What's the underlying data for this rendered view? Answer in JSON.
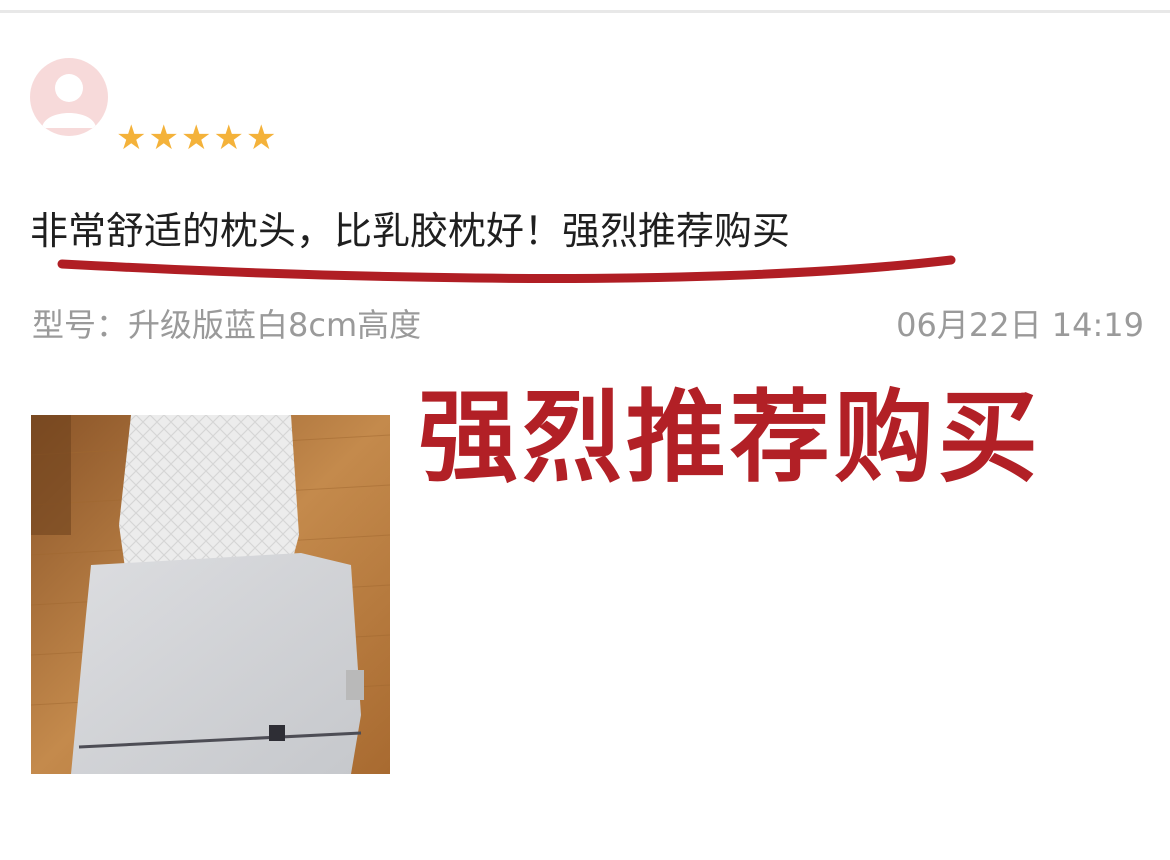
{
  "review": {
    "rating_stars": 5,
    "stars": [
      "★",
      "★",
      "★",
      "★",
      "★"
    ],
    "text": "非常舒适的枕头，比乳胶枕好！强烈推荐购买",
    "spec": "型号：升级版蓝白8cm高度",
    "date": "06月22日 14:19"
  },
  "overlay": {
    "text": "强烈推荐购买"
  },
  "colors": {
    "star": "#f4b23a",
    "overlay_red": "#b22026",
    "underline_red": "#b01e24",
    "meta_gray": "#9a9a9a",
    "avatar_bg": "#f7dada"
  },
  "icons": {
    "avatar": "default-user-avatar-icon",
    "star": "star-icon"
  }
}
